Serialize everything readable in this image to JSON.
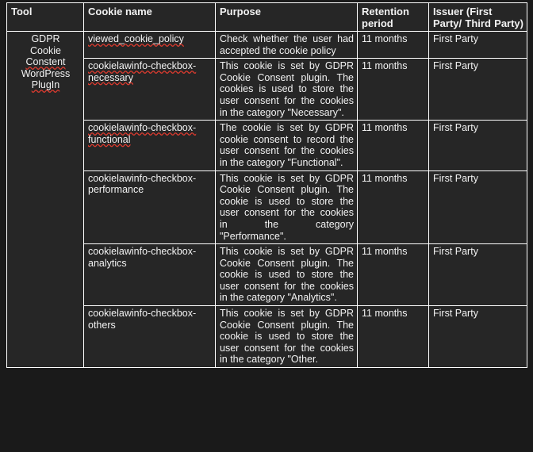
{
  "document": {
    "kind": "cookie-policy-table",
    "background_color": "#1a1a1a",
    "cell_color": "#262626",
    "border_color": "#ffffff",
    "text_color": "#f2f2f2",
    "spellcheck_underline_color": "#e03b2f"
  },
  "table": {
    "headers": {
      "tool": "Tool",
      "cookie_name": "Cookie name",
      "purpose": "Purpose",
      "retention_period": "Retention period",
      "issuer_line1": "Issuer",
      "issuer_line2": "(First",
      "issuer_line3": "Party/",
      "issuer_line4": "Third",
      "issuer_line5": "Party)",
      "issuer_full": "Issuer (First Party/ Third Party)"
    },
    "tool_label_lines": [
      "GDPR",
      "Cookie",
      "Constent",
      "WordPress",
      "PlugIn"
    ],
    "tool_label": "GDPR Cookie Constent WordPress PlugIn",
    "rows": [
      {
        "cookie_name": "viewed_cookie_policy",
        "purpose": "Check whether the user had accepted the cookie policy",
        "retention_period": "11 months",
        "issuer": "First Party"
      },
      {
        "cookie_name": "cookielawinfo-checkbox-necessary",
        "purpose": "This cookie is set by GDPR Cookie Consent plugin. The cookies is used to store the user consent for the cookies in the category \"Necessary\".",
        "retention_period": "11 months",
        "issuer": "First Party"
      },
      {
        "cookie_name": "cookielawinfo-checkbox-functional",
        "purpose": "The cookie is set by GDPR cookie consent to record the user consent for the cookies in the category \"Functional\".",
        "retention_period": "11 months",
        "issuer": "First Party"
      },
      {
        "cookie_name": "cookielawinfo-checkbox-performance",
        "purpose": "This cookie is set by GDPR Cookie Consent plugin. The cookie is used to store the user consent for the cookies in the category \"Performance\".",
        "retention_period": "11 months",
        "issuer": "First Party"
      },
      {
        "cookie_name": "cookielawinfo-checkbox-analytics",
        "purpose": "This cookie is set by GDPR Cookie Consent plugin. The cookie is used to store the user consent for the cookies in the category \"Analytics\".",
        "retention_period": "11 months",
        "issuer": "First Party"
      },
      {
        "cookie_name": "cookielawinfo-checkbox-others",
        "purpose": "This cookie is set by GDPR Cookie Consent plugin. The cookie is used to store the user consent for the cookies in the category \"Other.",
        "retention_period": "11 months",
        "issuer": "First Party"
      }
    ]
  }
}
